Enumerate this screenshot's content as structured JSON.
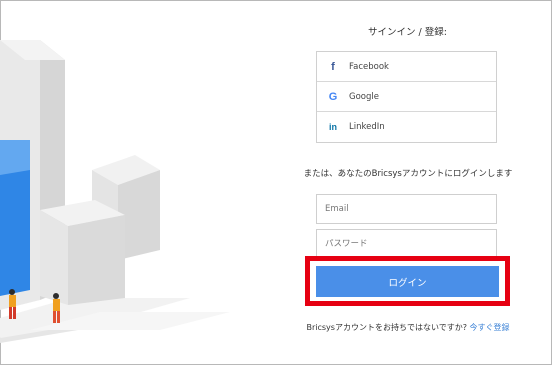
{
  "signin": {
    "title": "サインイン / 登録:",
    "social": [
      {
        "label": "Facebook",
        "icon": "facebook-icon",
        "glyph": "f"
      },
      {
        "label": "Google",
        "icon": "google-icon",
        "glyph": "G"
      },
      {
        "label": "LinkedIn",
        "icon": "linkedin-icon",
        "glyph": "in"
      }
    ],
    "or_text": "または、あなたのBricsysアカウントにログインします",
    "email_placeholder": "Email",
    "password_placeholder": "パスワード",
    "login_label": "ログイン",
    "signup_prompt": "Bricsysアカウントをお持ちではないですか?",
    "signup_link": "今すぐ登録"
  },
  "colors": {
    "accent": "#4a8fe8",
    "highlight": "#e60012",
    "link": "#3b82d6"
  }
}
